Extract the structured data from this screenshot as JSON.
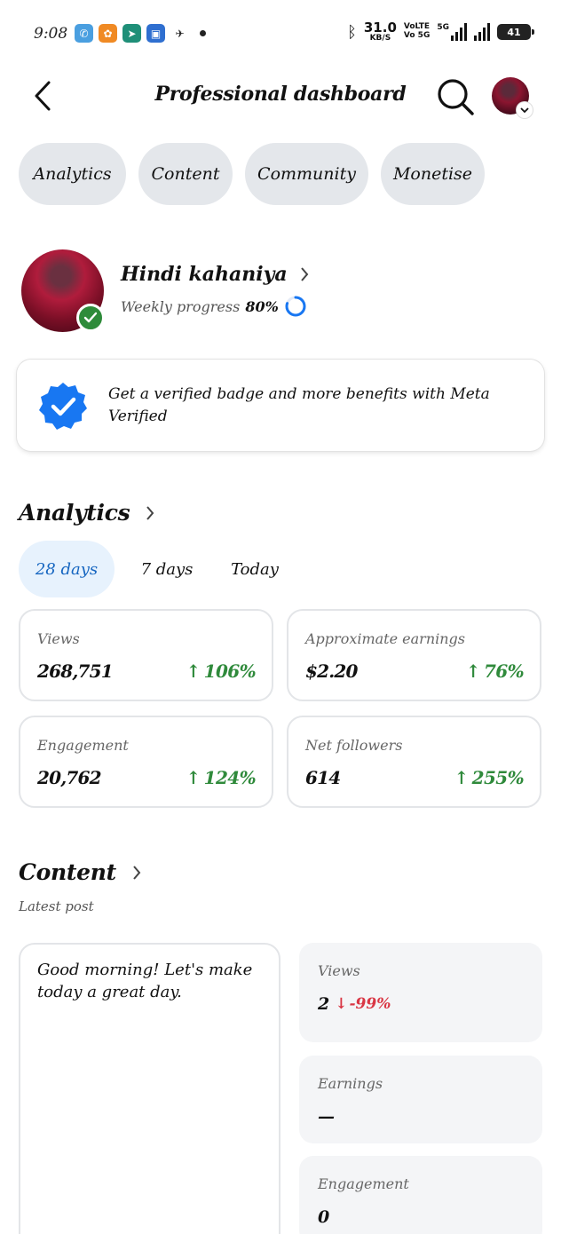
{
  "status_bar": {
    "time": "9:08",
    "speed_value": "31.0",
    "speed_unit": "KB/S",
    "volte_top": "VoLTE",
    "volte_bottom": "Vo 5G",
    "network": "5G",
    "battery": "41"
  },
  "header": {
    "title": "Professional dashboard"
  },
  "tabs": [
    {
      "label": "Analytics"
    },
    {
      "label": "Content"
    },
    {
      "label": "Community"
    },
    {
      "label": "Monetise"
    }
  ],
  "profile": {
    "name": "Hindi kahaniya",
    "progress_label": "Weekly progress",
    "progress_value": "80%",
    "progress_fraction": 0.8
  },
  "verified_card": {
    "text": "Get a verified badge and more benefits with Meta Verified"
  },
  "analytics": {
    "title": "Analytics",
    "ranges": [
      {
        "label": "28 days",
        "active": true
      },
      {
        "label": "7 days",
        "active": false
      },
      {
        "label": "Today",
        "active": false
      }
    ],
    "stats": [
      {
        "label": "Views",
        "value": "268,751",
        "change": "106%"
      },
      {
        "label": "Approximate earnings",
        "value": "$2.20",
        "change": "76%"
      },
      {
        "label": "Engagement",
        "value": "20,762",
        "change": "124%"
      },
      {
        "label": "Net followers",
        "value": "614",
        "change": "255%"
      }
    ]
  },
  "content": {
    "title": "Content",
    "latest_label": "Latest post",
    "post_text": "Good morning! Let's make today a great day.",
    "metrics": [
      {
        "label": "Views",
        "value": "2",
        "change": "-99%"
      },
      {
        "label": "Earnings",
        "value": "—"
      },
      {
        "label": "Engagement",
        "value": "0"
      }
    ]
  },
  "colors": {
    "positive": "#2f8a3b",
    "negative": "#d93644",
    "accent": "#1565c0",
    "verified_green": "#2e8b3a",
    "meta_blue": "#1877f2"
  }
}
